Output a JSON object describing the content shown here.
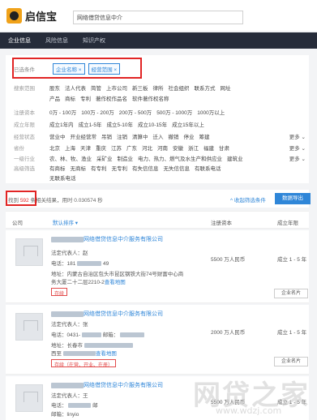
{
  "header": {
    "logo_text": "启信宝",
    "search_value": "网络借贷信息中介"
  },
  "tabs": [
    {
      "label": "企业信息"
    },
    {
      "label": "风险信息"
    },
    {
      "label": "知识产权"
    }
  ],
  "filters": {
    "selected_label": "已选条件",
    "selected_chips": [
      "企业名称 ×",
      "经营范围 ×"
    ],
    "rows": [
      {
        "label": "搜索范围",
        "options": [
          "股东",
          "法人代表",
          "简管",
          "上市公司",
          "新三板",
          "律所",
          "社会组织",
          "联系方式",
          "网址"
        ]
      },
      {
        "label": "",
        "options": [
          "产品",
          "商标",
          "专利",
          "著作权作品名",
          "软件著作权名称"
        ]
      },
      {
        "label": "注册资本",
        "options": [
          "0万 - 100万",
          "100万 - 200万",
          "200万 - 500万",
          "500万 - 1000万",
          "1000万以上"
        ]
      },
      {
        "label": "成立年限",
        "options": [
          "成立1年内",
          "成立1-5年",
          "成立5-10年",
          "成立10-15年",
          "成立15年以上"
        ]
      },
      {
        "label": "经营状态",
        "options": [
          "营业中",
          "开业经营常",
          "吊销",
          "注销",
          "清算中",
          "迁入",
          "撤销",
          "停业",
          "筹建"
        ]
      },
      {
        "label": "省份",
        "options": [
          "北京",
          "上海",
          "天津",
          "重庆",
          "江苏",
          "广东",
          "河北",
          "河南",
          "安徽",
          "浙江",
          "福建",
          "甘肃"
        ]
      },
      {
        "label": "一级行业",
        "options": [
          "农、林、牧、渔业",
          "采矿业",
          "制造业",
          "电力、热力、燃气及水生产和供应业",
          "建筑业"
        ]
      },
      {
        "label": "高级筛选",
        "options": [
          "有商标",
          "无商标",
          "有专利",
          "无专利",
          "有失信信息",
          "无失信信息",
          "有联系电话"
        ]
      },
      {
        "label": "",
        "options": [
          "无联系电话"
        ]
      }
    ]
  },
  "results": {
    "prefix": "找到",
    "count": "592",
    "suffix": "条相关结果，用时 0.030574 秒",
    "collapse_label": "^ 收起筛选条件",
    "export_label": "数据导出"
  },
  "table_header": {
    "company": "公司",
    "sort": "默认排序 ▾",
    "capital": "注册资本",
    "years": "成立年限"
  },
  "companies": [
    {
      "name": "网络借贷信息中介服务有限公司",
      "legal": "法定代表人：赵",
      "phone": "电话：181",
      "phone_tail": "49",
      "address": "地址：内蒙古自治区包头市昆区钢铁大街74号财富中心商",
      "address2": "务大厦二十二层2210-2",
      "map_link": "查看地图",
      "tag": "存续",
      "capital": "5500 万人民币",
      "years": "成立 1 - 5 年",
      "button": "企业名片"
    },
    {
      "name": "网络借贷信息中介服务有限公司",
      "legal": "法定代表人：张",
      "phone": "电话：0431-",
      "phone_mid": "邮箱：",
      "address": "地址：长春市",
      "address2": "西至",
      "map_link": "查看地图",
      "tag": "存续（在营、开业、在册）",
      "capital": "2000 万人民币",
      "years": "成立 1 - 5 年",
      "button": "企业名片"
    },
    {
      "name": "网络借贷信息中介服务有限公司",
      "legal": "法定代表人：王",
      "phone": "电话：",
      "phone_mid": "邮",
      "address": "邮箱：linyio",
      "capital": "5500 万人民币",
      "years": "成立 1 - 5 年"
    }
  ],
  "watermark": {
    "text": "网贷之家",
    "url": "www.wdzj.com"
  }
}
